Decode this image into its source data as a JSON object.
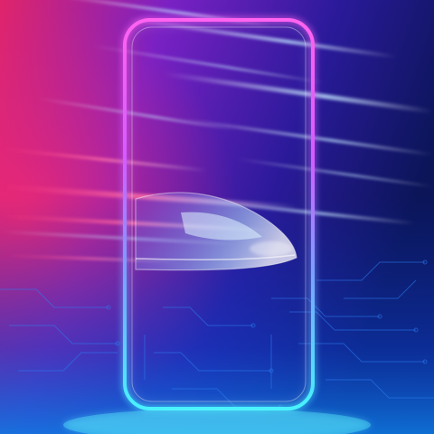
{
  "scene": {
    "colors": {
      "background_left": "#e0246a",
      "background_mid": "#5a1fb8",
      "background_right": "#0a1560",
      "background_bottom": "#0e6fd8",
      "frame_glow_top": "#ff4fe6",
      "frame_glow_bottom": "#3ff0ff",
      "speed_streak": "#9fd8ff",
      "circuit": "#2b7df2"
    },
    "icons": [
      "phone-frame-outline",
      "bullet-train",
      "circuit-board",
      "speed-lines"
    ]
  }
}
